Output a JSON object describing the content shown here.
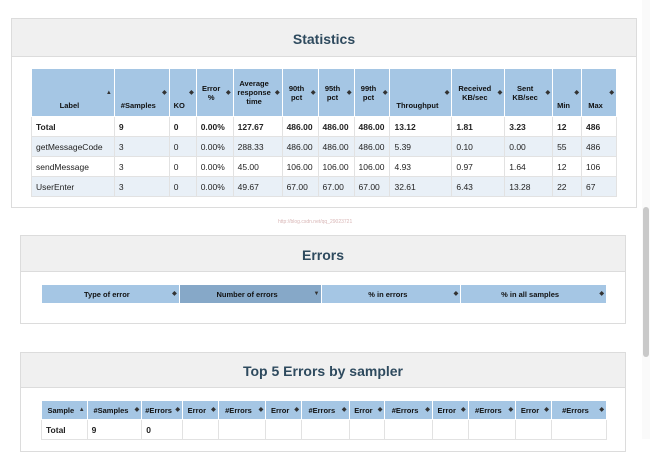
{
  "statistics": {
    "title": "Statistics",
    "headers": [
      {
        "label": "Label",
        "icon": "sort-asc-icon"
      },
      {
        "label": "#Samples",
        "icon": "sort-both-icon"
      },
      {
        "label": "KO",
        "icon": "sort-both-icon"
      },
      {
        "label": "Error %",
        "icon": "sort-both-icon"
      },
      {
        "label": "Average response time",
        "icon": "sort-both-icon"
      },
      {
        "label": "90th pct",
        "icon": "sort-both-icon"
      },
      {
        "label": "95th pct",
        "icon": "sort-both-icon"
      },
      {
        "label": "99th pct",
        "icon": "sort-both-icon"
      },
      {
        "label": "Throughput",
        "icon": "sort-both-icon"
      },
      {
        "label": "Received KB/sec",
        "icon": "sort-both-icon"
      },
      {
        "label": "Sent KB/sec",
        "icon": "sort-both-icon"
      },
      {
        "label": "Min",
        "icon": "sort-both-icon"
      },
      {
        "label": "Max",
        "icon": "sort-both-icon"
      }
    ],
    "rows": [
      [
        "Total",
        "9",
        "0",
        "0.00%",
        "127.67",
        "486.00",
        "486.00",
        "486.00",
        "13.12",
        "1.81",
        "3.23",
        "12",
        "486"
      ],
      [
        "getMessageCode",
        "3",
        "0",
        "0.00%",
        "288.33",
        "486.00",
        "486.00",
        "486.00",
        "5.39",
        "0.10",
        "0.00",
        "55",
        "486"
      ],
      [
        "sendMessage",
        "3",
        "0",
        "0.00%",
        "45.00",
        "106.00",
        "106.00",
        "106.00",
        "4.93",
        "0.97",
        "1.64",
        "12",
        "106"
      ],
      [
        "UserEnter",
        "3",
        "0",
        "0.00%",
        "49.67",
        "67.00",
        "67.00",
        "67.00",
        "32.61",
        "6.43",
        "13.28",
        "22",
        "67"
      ]
    ]
  },
  "watermark": "http://blog.csdn.net/qq_29023721",
  "errors": {
    "title": "Errors",
    "headers": [
      {
        "label": "Type of error",
        "icon": "sort-both-icon"
      },
      {
        "label": "Number of errors",
        "icon": "sort-desc-icon"
      },
      {
        "label": "% in errors",
        "icon": "sort-both-icon"
      },
      {
        "label": "% in all samples",
        "icon": "sort-both-icon"
      }
    ]
  },
  "top5": {
    "title": "Top 5 Errors by sampler",
    "headers": [
      {
        "label": "Sample",
        "icon": "sort-asc-icon"
      },
      {
        "label": "#Samples",
        "icon": "sort-both-icon"
      },
      {
        "label": "#Errors",
        "icon": "sort-both-icon"
      },
      {
        "label": "Error",
        "icon": "sort-both-icon"
      },
      {
        "label": "#Errors",
        "icon": "sort-both-icon"
      },
      {
        "label": "Error",
        "icon": "sort-both-icon"
      },
      {
        "label": "#Errors",
        "icon": "sort-both-icon"
      },
      {
        "label": "Error",
        "icon": "sort-both-icon"
      },
      {
        "label": "#Errors",
        "icon": "sort-both-icon"
      },
      {
        "label": "Error",
        "icon": "sort-both-icon"
      },
      {
        "label": "#Errors",
        "icon": "sort-both-icon"
      },
      {
        "label": "Error",
        "icon": "sort-both-icon"
      },
      {
        "label": "#Errors",
        "icon": "sort-both-icon"
      }
    ],
    "rows": [
      [
        "Total",
        "9",
        "0",
        "",
        "",
        "",
        "",
        "",
        "",
        "",
        "",
        "",
        ""
      ]
    ]
  }
}
